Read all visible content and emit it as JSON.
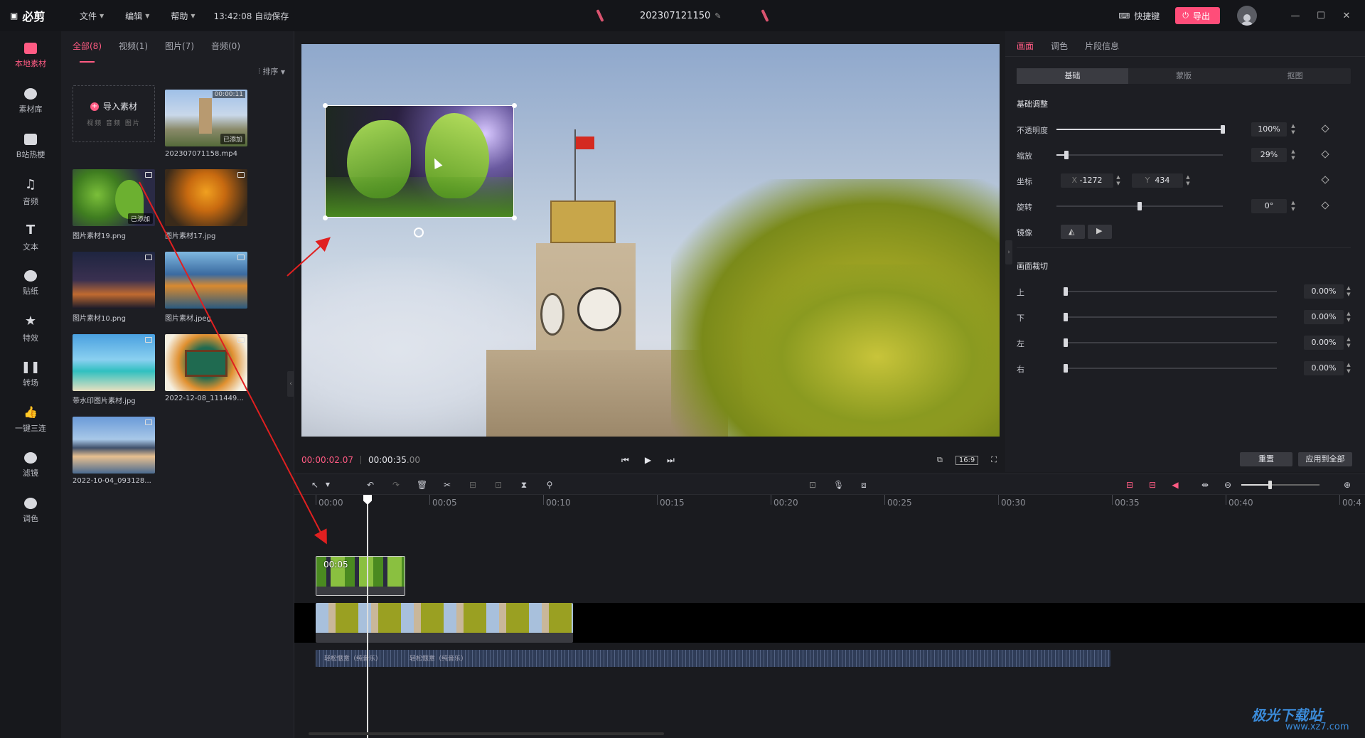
{
  "app": {
    "logo": "必剪",
    "autosave": "13:42:08 自动保存",
    "project_title": "202307121150"
  },
  "menus": [
    {
      "label": "文件"
    },
    {
      "label": "编辑"
    },
    {
      "label": "帮助"
    }
  ],
  "topright": {
    "shortcut": "快捷键",
    "export": "导出"
  },
  "sidebar": [
    {
      "label": "本地素材",
      "active": true
    },
    {
      "label": "素材库"
    },
    {
      "label": "B站热梗"
    },
    {
      "label": "音频"
    },
    {
      "label": "文本"
    },
    {
      "label": "贴纸"
    },
    {
      "label": "特效"
    },
    {
      "label": "转场"
    },
    {
      "label": "一键三连"
    },
    {
      "label": "滤镜"
    },
    {
      "label": "调色"
    }
  ],
  "media": {
    "tabs": [
      {
        "label": "全部(8)"
      },
      {
        "label": "视频(1)"
      },
      {
        "label": "图片(7)"
      },
      {
        "label": "音频(0)"
      }
    ],
    "sort": "排序",
    "import": {
      "label": "导入素材",
      "sub": "视频 音频 图片"
    },
    "items": [
      {
        "name": "202307071158.mp4",
        "badge": "已添加",
        "duration": "00:00:11"
      },
      {
        "name": "图片素材19.png",
        "badge": "已添加"
      },
      {
        "name": "图片素材17.jpg"
      },
      {
        "name": "图片素材10.png"
      },
      {
        "name": "图片素材.jpeg"
      },
      {
        "name": "带水印图片素材.jpg"
      },
      {
        "name": "2022-12-08_111449..."
      },
      {
        "name": "2022-10-04_093128..."
      }
    ]
  },
  "preview": {
    "current": "00:00:02.07",
    "total": "00:00:35",
    "total_ms": ".00",
    "ratio": "16:9"
  },
  "props": {
    "tabs": [
      {
        "label": "画面"
      },
      {
        "label": "调色"
      },
      {
        "label": "片段信息"
      }
    ],
    "segments": [
      {
        "label": "基础"
      },
      {
        "label": "蒙版"
      },
      {
        "label": "抠图"
      }
    ],
    "basic_title": "基础调整",
    "opacity": {
      "label": "不透明度",
      "value": "100%",
      "level": 1.0
    },
    "scale": {
      "label": "缩放",
      "value": "29%",
      "level": 0.06
    },
    "position": {
      "label": "坐标",
      "x_label": "X",
      "x": "-1272",
      "y_label": "Y",
      "y": "434"
    },
    "rotation": {
      "label": "旋转",
      "value": "0°",
      "level": 0.5
    },
    "mirror": {
      "label": "镜像"
    },
    "crop_title": "画面裁切",
    "crop": [
      {
        "label": "上",
        "value": "0.00%"
      },
      {
        "label": "下",
        "value": "0.00%"
      },
      {
        "label": "左",
        "value": "0.00%"
      },
      {
        "label": "右",
        "value": "0.00%"
      }
    ],
    "reset": "重置",
    "apply_all": "应用到全部"
  },
  "timeline": {
    "ticks": [
      "00:00",
      "00:05",
      "00:10",
      "00:15",
      "00:20",
      "00:25",
      "00:30",
      "00:35",
      "00:40",
      "00:4"
    ],
    "overlay_clip": {
      "label": "00:05"
    },
    "audio": {
      "segments": [
        "轻松惬意（纯音乐）",
        "轻松惬意（纯音乐）"
      ]
    }
  },
  "watermark": {
    "main": "极光下载站",
    "url": "www.xz7.com"
  },
  "colors": {
    "accent": "#ff5b83",
    "export_bg": "#ff4d79"
  }
}
